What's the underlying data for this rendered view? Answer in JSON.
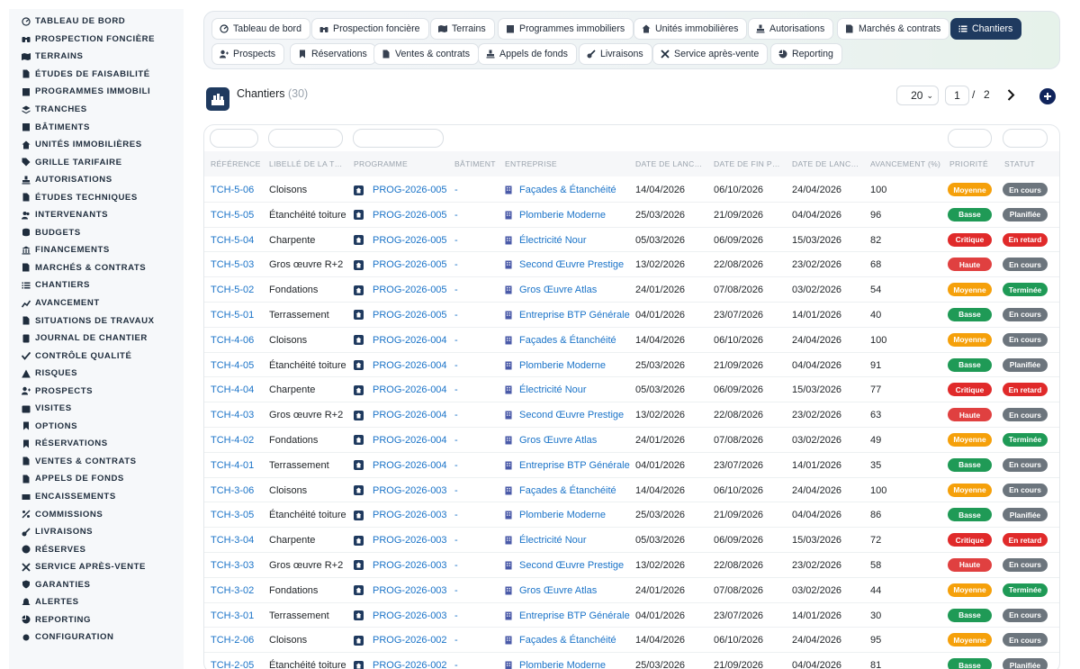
{
  "sidebar": {
    "items": [
      {
        "label": "TABLEAU DE BORD",
        "icon": "dashboard-icon"
      },
      {
        "label": "PROSPECTION FONCIÈRE",
        "icon": "binoculars-icon"
      },
      {
        "label": "TERRAINS",
        "icon": "map-icon"
      },
      {
        "label": "ÉTUDES DE FAISABILITÉ",
        "icon": "document-icon"
      },
      {
        "label": "PROGRAMMES IMMOBILI",
        "icon": "building-icon"
      },
      {
        "label": "TRANCHES",
        "icon": "layers-icon"
      },
      {
        "label": "BÂTIMENTS",
        "icon": "building-icon"
      },
      {
        "label": "UNITÉS IMMOBILIÈRES",
        "icon": "home-icon"
      },
      {
        "label": "GRILLE TARIFAIRE",
        "icon": "tag-icon"
      },
      {
        "label": "AUTORISATIONS",
        "icon": "stamp-icon"
      },
      {
        "label": "ÉTUDES TECHNIQUES",
        "icon": "document-icon"
      },
      {
        "label": "INTERVENANTS",
        "icon": "users-icon"
      },
      {
        "label": "BUDGETS",
        "icon": "coins-icon"
      },
      {
        "label": "FINANCEMENTS",
        "icon": "bank-icon"
      },
      {
        "label": "MARCHÉS & CONTRATS",
        "icon": "contract-icon"
      },
      {
        "label": "CHANTIERS",
        "icon": "list-icon"
      },
      {
        "label": "AVANCEMENT",
        "icon": "chart-line-icon"
      },
      {
        "label": "SITUATIONS DE TRAVAUX",
        "icon": "document-icon"
      },
      {
        "label": "JOURNAL DE CHANTIER",
        "icon": "book-icon"
      },
      {
        "label": "CONTRÔLE QUALITÉ",
        "icon": "check-icon"
      },
      {
        "label": "RISQUES",
        "icon": "warning-icon"
      },
      {
        "label": "PROSPECTS",
        "icon": "user-plus-icon"
      },
      {
        "label": "VISITES",
        "icon": "calendar-icon"
      },
      {
        "label": "OPTIONS",
        "icon": "bookmark-icon"
      },
      {
        "label": "RÉSERVATIONS",
        "icon": "bookmark-icon"
      },
      {
        "label": "VENTES & CONTRATS",
        "icon": "document-icon"
      },
      {
        "label": "APPELS DE FONDS",
        "icon": "document-icon"
      },
      {
        "label": "ENCAISSEMENTS",
        "icon": "cash-icon"
      },
      {
        "label": "COMMISSIONS",
        "icon": "percent-icon"
      },
      {
        "label": "LIVRAISONS",
        "icon": "key-icon"
      },
      {
        "label": "RÉSERVES",
        "icon": "alert-circle-icon"
      },
      {
        "label": "SERVICE APRÈS-VENTE",
        "icon": "tools-icon"
      },
      {
        "label": "GARANTIES",
        "icon": "shield-icon"
      },
      {
        "label": "ALERTES",
        "icon": "bell-icon"
      },
      {
        "label": "REPORTING",
        "icon": "pie-chart-icon"
      },
      {
        "label": "CONFIGURATION",
        "icon": "gear-icon"
      }
    ]
  },
  "tabs": [
    {
      "label": "Tableau de bord",
      "icon": "dashboard-icon",
      "active": false
    },
    {
      "label": "Prospection foncière",
      "icon": "binoculars-icon",
      "active": false
    },
    {
      "label": "Terrains",
      "icon": "map-icon",
      "active": false
    },
    {
      "label": "Programmes immobiliers",
      "icon": "building-icon",
      "active": false
    },
    {
      "label": "Unités immobilières",
      "icon": "home-icon",
      "active": false
    },
    {
      "label": "Autorisations",
      "icon": "stamp-icon",
      "active": false
    },
    {
      "label": "Marchés & contrats",
      "icon": "contract-icon",
      "active": false
    },
    {
      "label": "Chantiers",
      "icon": "list-icon",
      "active": true
    },
    {
      "label": "Prospects",
      "icon": "user-plus-icon",
      "active": false
    },
    {
      "label": "Réservations",
      "icon": "bookmark-icon",
      "active": false
    },
    {
      "label": "Ventes & contrats",
      "icon": "document-icon",
      "active": false
    },
    {
      "label": "Appels de fonds",
      "icon": "stamp-icon",
      "active": false
    },
    {
      "label": "Livraisons",
      "icon": "key-icon",
      "active": false
    },
    {
      "label": "Service après-vente",
      "icon": "tools-icon",
      "active": false
    },
    {
      "label": "Reporting",
      "icon": "pie-chart-icon",
      "active": false
    }
  ],
  "header": {
    "title": "Chantiers",
    "count": "(30)",
    "icon": "chantier-icon"
  },
  "pagination": {
    "per_page": "20",
    "page": "1",
    "separator": "/",
    "total_pages": "2"
  },
  "table": {
    "columns": [
      "RÉFÉRENCE",
      "LIBELLÉ DE LA T…",
      "PROGRAMME",
      "BÂTIMENT",
      "ENTREPRISE",
      "DATE DE LANC…",
      "DATE DE FIN P…",
      "DATE DE LANC…",
      "AVANCEMENT (%)",
      "PRIORITÉ",
      "STATUT"
    ],
    "rows": [
      {
        "ref": "TCH-5-06",
        "libelle": "Cloisons",
        "programme": "PROG-2026-005",
        "batiment": "-",
        "entreprise": "Façades & Étanchéité",
        "d1": "14/04/2026",
        "d2": "06/10/2026",
        "d3": "24/04/2026",
        "avancement": "100",
        "priorite": "Moyenne",
        "statut": "En cours"
      },
      {
        "ref": "TCH-5-05",
        "libelle": "Étanchéité toiture",
        "programme": "PROG-2026-005",
        "batiment": "-",
        "entreprise": "Plomberie Moderne",
        "d1": "25/03/2026",
        "d2": "21/09/2026",
        "d3": "04/04/2026",
        "avancement": "96",
        "priorite": "Basse",
        "statut": "Planifiée"
      },
      {
        "ref": "TCH-5-04",
        "libelle": "Charpente",
        "programme": "PROG-2026-005",
        "batiment": "-",
        "entreprise": "Électricité Nour",
        "d1": "05/03/2026",
        "d2": "06/09/2026",
        "d3": "15/03/2026",
        "avancement": "82",
        "priorite": "Critique",
        "statut": "En retard"
      },
      {
        "ref": "TCH-5-03",
        "libelle": "Gros œuvre R+2",
        "programme": "PROG-2026-005",
        "batiment": "-",
        "entreprise": "Second Œuvre Prestige",
        "d1": "13/02/2026",
        "d2": "22/08/2026",
        "d3": "23/02/2026",
        "avancement": "68",
        "priorite": "Haute",
        "statut": "En cours"
      },
      {
        "ref": "TCH-5-02",
        "libelle": "Fondations",
        "programme": "PROG-2026-005",
        "batiment": "-",
        "entreprise": "Gros Œuvre Atlas",
        "d1": "24/01/2026",
        "d2": "07/08/2026",
        "d3": "03/02/2026",
        "avancement": "54",
        "priorite": "Moyenne",
        "statut": "Terminée"
      },
      {
        "ref": "TCH-5-01",
        "libelle": "Terrassement",
        "programme": "PROG-2026-005",
        "batiment": "-",
        "entreprise": "Entreprise BTP Générale",
        "d1": "04/01/2026",
        "d2": "23/07/2026",
        "d3": "14/01/2026",
        "avancement": "40",
        "priorite": "Basse",
        "statut": "En cours"
      },
      {
        "ref": "TCH-4-06",
        "libelle": "Cloisons",
        "programme": "PROG-2026-004",
        "batiment": "-",
        "entreprise": "Façades & Étanchéité",
        "d1": "14/04/2026",
        "d2": "06/10/2026",
        "d3": "24/04/2026",
        "avancement": "100",
        "priorite": "Moyenne",
        "statut": "En cours"
      },
      {
        "ref": "TCH-4-05",
        "libelle": "Étanchéité toiture",
        "programme": "PROG-2026-004",
        "batiment": "-",
        "entreprise": "Plomberie Moderne",
        "d1": "25/03/2026",
        "d2": "21/09/2026",
        "d3": "04/04/2026",
        "avancement": "91",
        "priorite": "Basse",
        "statut": "Planifiée"
      },
      {
        "ref": "TCH-4-04",
        "libelle": "Charpente",
        "programme": "PROG-2026-004",
        "batiment": "-",
        "entreprise": "Électricité Nour",
        "d1": "05/03/2026",
        "d2": "06/09/2026",
        "d3": "15/03/2026",
        "avancement": "77",
        "priorite": "Critique",
        "statut": "En retard"
      },
      {
        "ref": "TCH-4-03",
        "libelle": "Gros œuvre R+2",
        "programme": "PROG-2026-004",
        "batiment": "-",
        "entreprise": "Second Œuvre Prestige",
        "d1": "13/02/2026",
        "d2": "22/08/2026",
        "d3": "23/02/2026",
        "avancement": "63",
        "priorite": "Haute",
        "statut": "En cours"
      },
      {
        "ref": "TCH-4-02",
        "libelle": "Fondations",
        "programme": "PROG-2026-004",
        "batiment": "-",
        "entreprise": "Gros Œuvre Atlas",
        "d1": "24/01/2026",
        "d2": "07/08/2026",
        "d3": "03/02/2026",
        "avancement": "49",
        "priorite": "Moyenne",
        "statut": "Terminée"
      },
      {
        "ref": "TCH-4-01",
        "libelle": "Terrassement",
        "programme": "PROG-2026-004",
        "batiment": "-",
        "entreprise": "Entreprise BTP Générale",
        "d1": "04/01/2026",
        "d2": "23/07/2026",
        "d3": "14/01/2026",
        "avancement": "35",
        "priorite": "Basse",
        "statut": "En cours"
      },
      {
        "ref": "TCH-3-06",
        "libelle": "Cloisons",
        "programme": "PROG-2026-003",
        "batiment": "-",
        "entreprise": "Façades & Étanchéité",
        "d1": "14/04/2026",
        "d2": "06/10/2026",
        "d3": "24/04/2026",
        "avancement": "100",
        "priorite": "Moyenne",
        "statut": "En cours"
      },
      {
        "ref": "TCH-3-05",
        "libelle": "Étanchéité toiture",
        "programme": "PROG-2026-003",
        "batiment": "-",
        "entreprise": "Plomberie Moderne",
        "d1": "25/03/2026",
        "d2": "21/09/2026",
        "d3": "04/04/2026",
        "avancement": "86",
        "priorite": "Basse",
        "statut": "Planifiée"
      },
      {
        "ref": "TCH-3-04",
        "libelle": "Charpente",
        "programme": "PROG-2026-003",
        "batiment": "-",
        "entreprise": "Électricité Nour",
        "d1": "05/03/2026",
        "d2": "06/09/2026",
        "d3": "15/03/2026",
        "avancement": "72",
        "priorite": "Critique",
        "statut": "En retard"
      },
      {
        "ref": "TCH-3-03",
        "libelle": "Gros œuvre R+2",
        "programme": "PROG-2026-003",
        "batiment": "-",
        "entreprise": "Second Œuvre Prestige",
        "d1": "13/02/2026",
        "d2": "22/08/2026",
        "d3": "23/02/2026",
        "avancement": "58",
        "priorite": "Haute",
        "statut": "En cours"
      },
      {
        "ref": "TCH-3-02",
        "libelle": "Fondations",
        "programme": "PROG-2026-003",
        "batiment": "-",
        "entreprise": "Gros Œuvre Atlas",
        "d1": "24/01/2026",
        "d2": "07/08/2026",
        "d3": "03/02/2026",
        "avancement": "44",
        "priorite": "Moyenne",
        "statut": "Terminée"
      },
      {
        "ref": "TCH-3-01",
        "libelle": "Terrassement",
        "programme": "PROG-2026-003",
        "batiment": "-",
        "entreprise": "Entreprise BTP Générale",
        "d1": "04/01/2026",
        "d2": "23/07/2026",
        "d3": "14/01/2026",
        "avancement": "30",
        "priorite": "Basse",
        "statut": "En cours"
      },
      {
        "ref": "TCH-2-06",
        "libelle": "Cloisons",
        "programme": "PROG-2026-002",
        "batiment": "-",
        "entreprise": "Façades & Étanchéité",
        "d1": "14/04/2026",
        "d2": "06/10/2026",
        "d3": "24/04/2026",
        "avancement": "95",
        "priorite": "Moyenne",
        "statut": "En cours"
      },
      {
        "ref": "TCH-2-05",
        "libelle": "Étanchéité toiture",
        "programme": "PROG-2026-002",
        "batiment": "-",
        "entreprise": "Plomberie Moderne",
        "d1": "25/03/2026",
        "d2": "21/09/2026",
        "d3": "04/04/2026",
        "avancement": "81",
        "priorite": "Basse",
        "statut": "Planifiée"
      }
    ]
  },
  "colors": {
    "primary": "#1f3a5f",
    "link": "#1a73c8",
    "priority": {
      "Moyenne": "#f5a00a",
      "Basse": "#1f9a56",
      "Critique": "#e02a2a",
      "Haute": "#e04040"
    },
    "status": {
      "En cours": "#6c757d",
      "Planifiée": "#6c757d",
      "En retard": "#e02a2a",
      "Terminée": "#1f9a56"
    }
  }
}
